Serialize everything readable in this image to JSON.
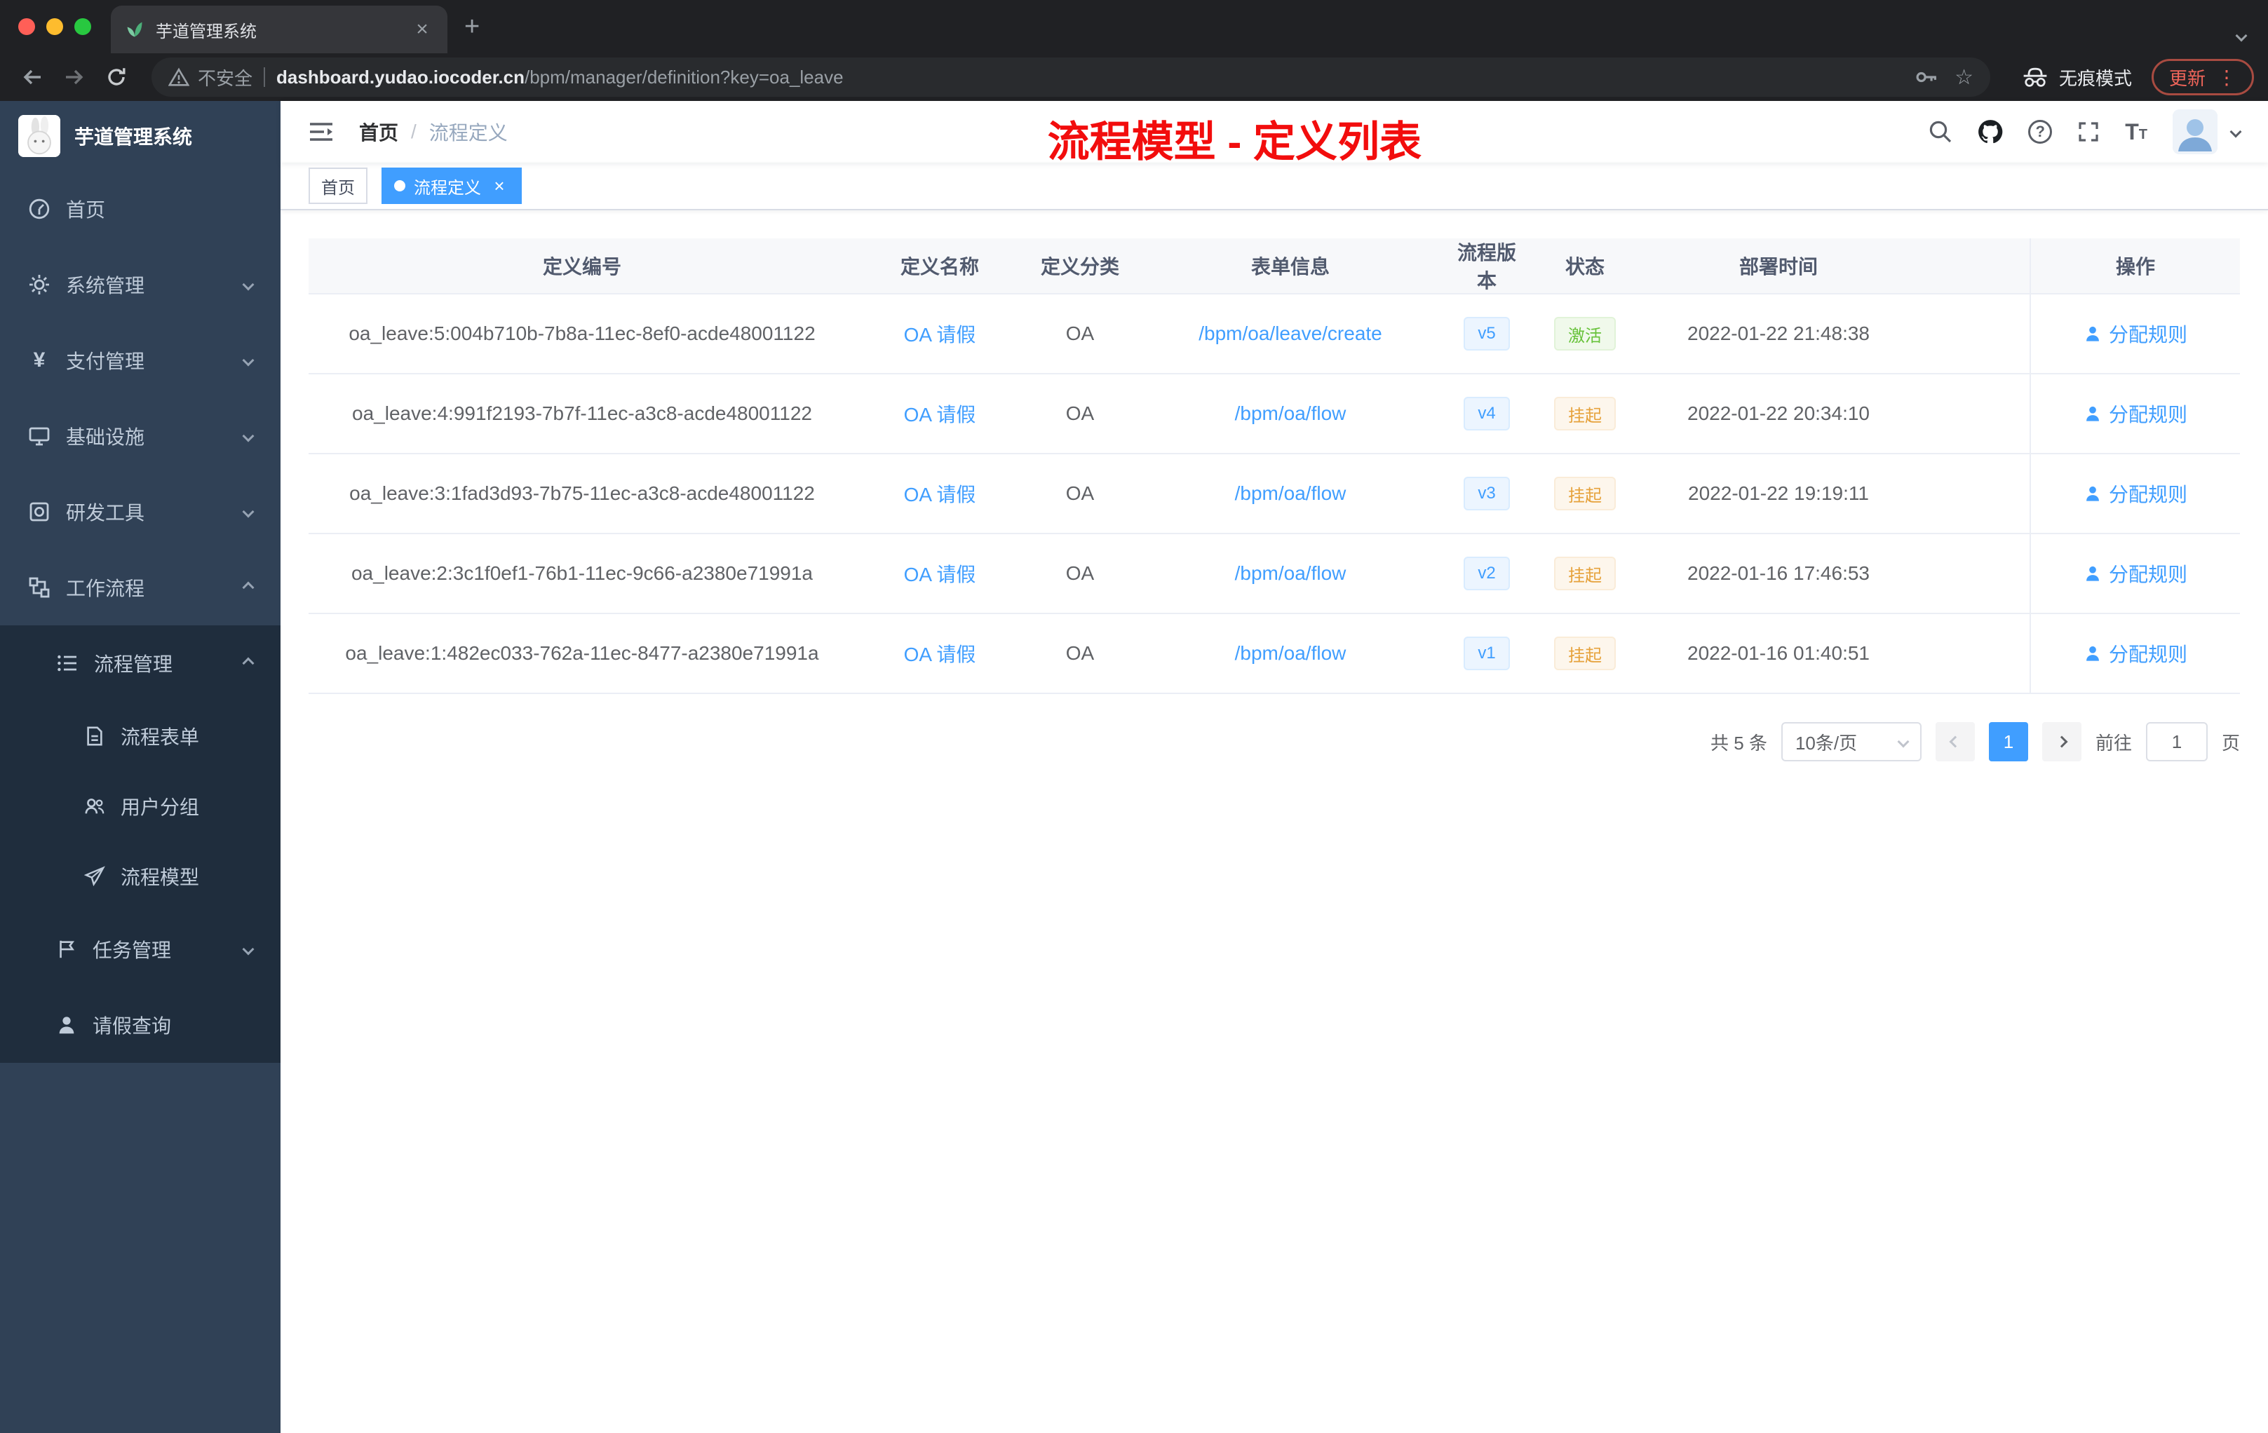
{
  "browser": {
    "tab_title": "芋道管理系统",
    "security_label": "不安全",
    "url_host": "dashboard.yudao.iocoder.cn",
    "url_path": "/bpm/manager/definition?key=oa_leave",
    "incognito_label": "无痕模式",
    "update_label": "更新"
  },
  "icons": {
    "close": "×",
    "new_tab": "+",
    "star": "☆",
    "question": "?",
    "dots": "⋮",
    "pay": "¥",
    "font_large": "T",
    "font_small": "T",
    "breadcrumb_separator": "/"
  },
  "sidebar": {
    "brand": "芋道管理系统",
    "menu": [
      {
        "label": "首页"
      },
      {
        "label": "系统管理"
      },
      {
        "label": "支付管理"
      },
      {
        "label": "基础设施"
      },
      {
        "label": "研发工具"
      },
      {
        "label": "工作流程"
      },
      {
        "label": "流程管理"
      },
      {
        "label": "流程表单"
      },
      {
        "label": "用户分组"
      },
      {
        "label": "流程模型"
      },
      {
        "label": "任务管理"
      },
      {
        "label": "请假查询"
      }
    ]
  },
  "navbar": {
    "breadcrumb_home": "首页",
    "breadcrumb_current": "流程定义",
    "annotation": "流程模型 - 定义列表"
  },
  "tags": {
    "home": "首页",
    "active": "流程定义"
  },
  "table": {
    "columns": [
      "定义编号",
      "定义名称",
      "定义分类",
      "表单信息",
      "流程版本",
      "状态",
      "部署时间",
      "操作"
    ],
    "rows": [
      {
        "id": "oa_leave:5:004b710b-7b8a-11ec-8ef0-acde48001122",
        "name": "OA 请假",
        "category": "OA",
        "form": "/bpm/oa/leave/create",
        "version": "v5",
        "status": "激活",
        "status_type": "success",
        "deploy_time": "2022-01-22 21:48:38",
        "action": "分配规则"
      },
      {
        "id": "oa_leave:4:991f2193-7b7f-11ec-a3c8-acde48001122",
        "name": "OA 请假",
        "category": "OA",
        "form": "/bpm/oa/flow",
        "version": "v4",
        "status": "挂起",
        "status_type": "warning",
        "deploy_time": "2022-01-22 20:34:10",
        "action": "分配规则"
      },
      {
        "id": "oa_leave:3:1fad3d93-7b75-11ec-a3c8-acde48001122",
        "name": "OA 请假",
        "category": "OA",
        "form": "/bpm/oa/flow",
        "version": "v3",
        "status": "挂起",
        "status_type": "warning",
        "deploy_time": "2022-01-22 19:19:11",
        "action": "分配规则"
      },
      {
        "id": "oa_leave:2:3c1f0ef1-76b1-11ec-9c66-a2380e71991a",
        "name": "OA 请假",
        "category": "OA",
        "form": "/bpm/oa/flow",
        "version": "v2",
        "status": "挂起",
        "status_type": "warning",
        "deploy_time": "2022-01-16 17:46:53",
        "action": "分配规则"
      },
      {
        "id": "oa_leave:1:482ec033-762a-11ec-8477-a2380e71991a",
        "name": "OA 请假",
        "category": "OA",
        "form": "/bpm/oa/flow",
        "version": "v1",
        "status": "挂起",
        "status_type": "warning",
        "deploy_time": "2022-01-16 01:40:51",
        "action": "分配规则"
      }
    ]
  },
  "pagination": {
    "total": "共 5 条",
    "page_size": "10条/页",
    "page": "1",
    "goto_label": "前往",
    "goto_value": "1",
    "unit_label": "页"
  }
}
